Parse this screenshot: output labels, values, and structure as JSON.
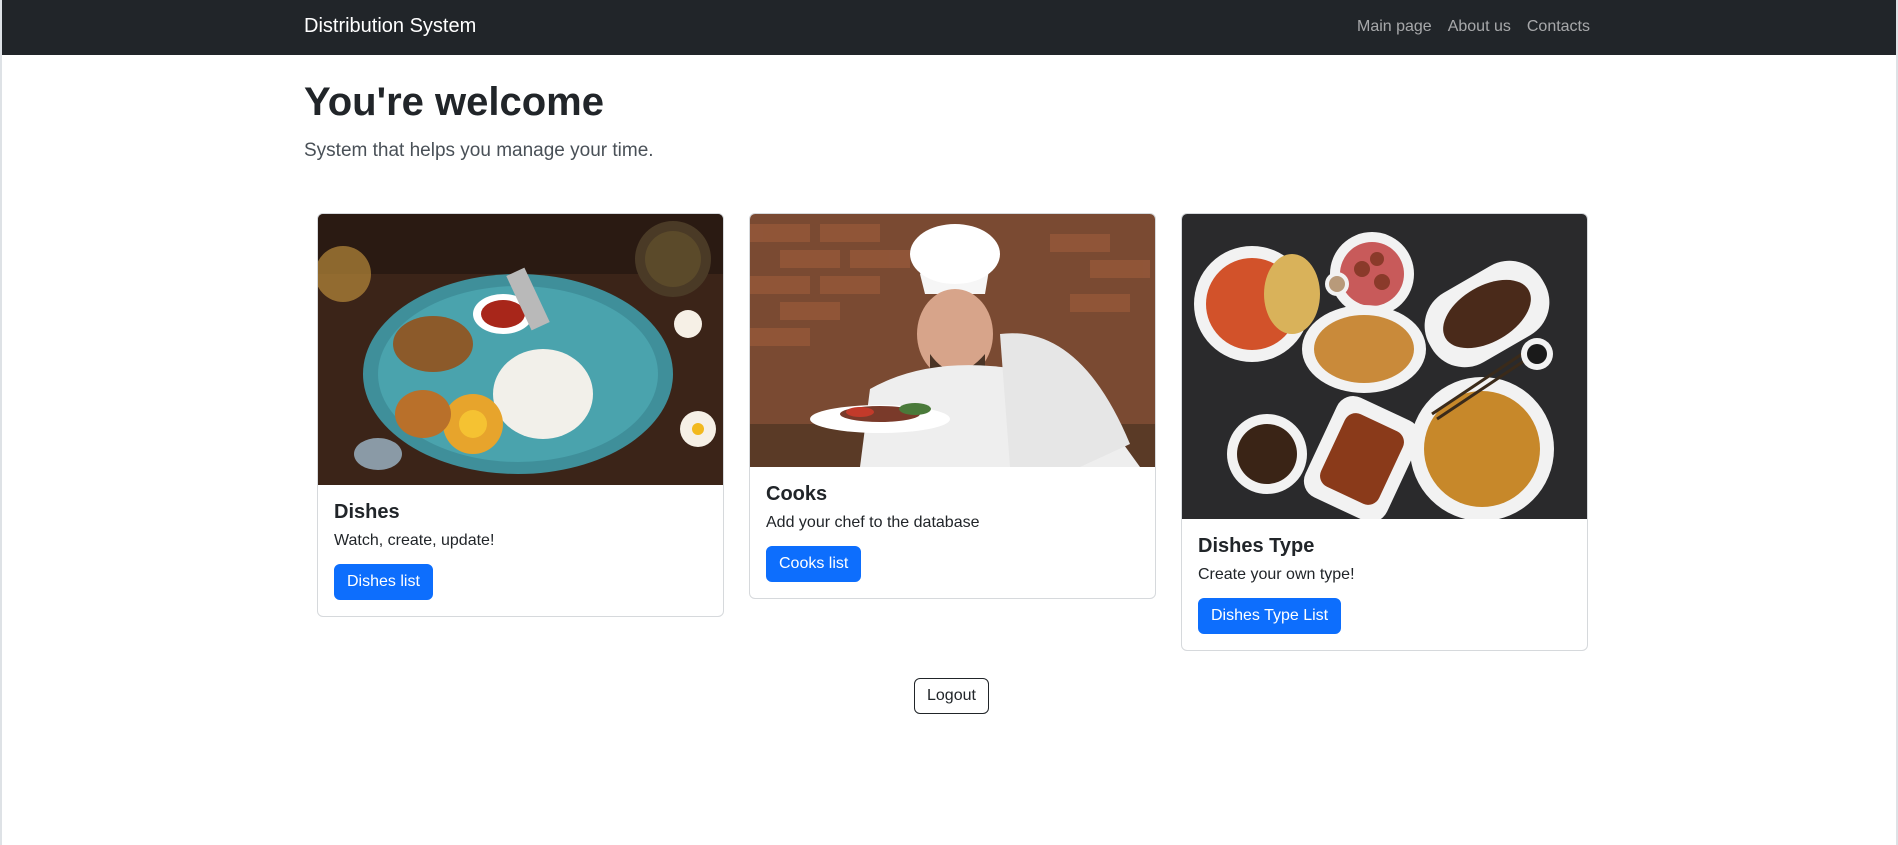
{
  "navbar": {
    "brand": "Distribution System",
    "links": [
      "Main page",
      "About us",
      "Contacts"
    ]
  },
  "hero": {
    "title": "You're welcome",
    "subtitle": "System that helps you manage your time."
  },
  "cards": [
    {
      "title": "Dishes",
      "text": "Watch, create, update!",
      "button": "Dishes list",
      "image": "plated-rice-dish-photo"
    },
    {
      "title": "Cooks",
      "text": "Add your chef to the database",
      "button": "Cooks list",
      "image": "chef-plating-photo"
    },
    {
      "title": "Dishes Type",
      "text": "Create your own type!",
      "button": "Dishes Type List",
      "image": "asian-dishes-spread-photo"
    }
  ],
  "logout": "Logout",
  "colors": {
    "navbar_bg": "#212529",
    "primary": "#0d6efd"
  }
}
